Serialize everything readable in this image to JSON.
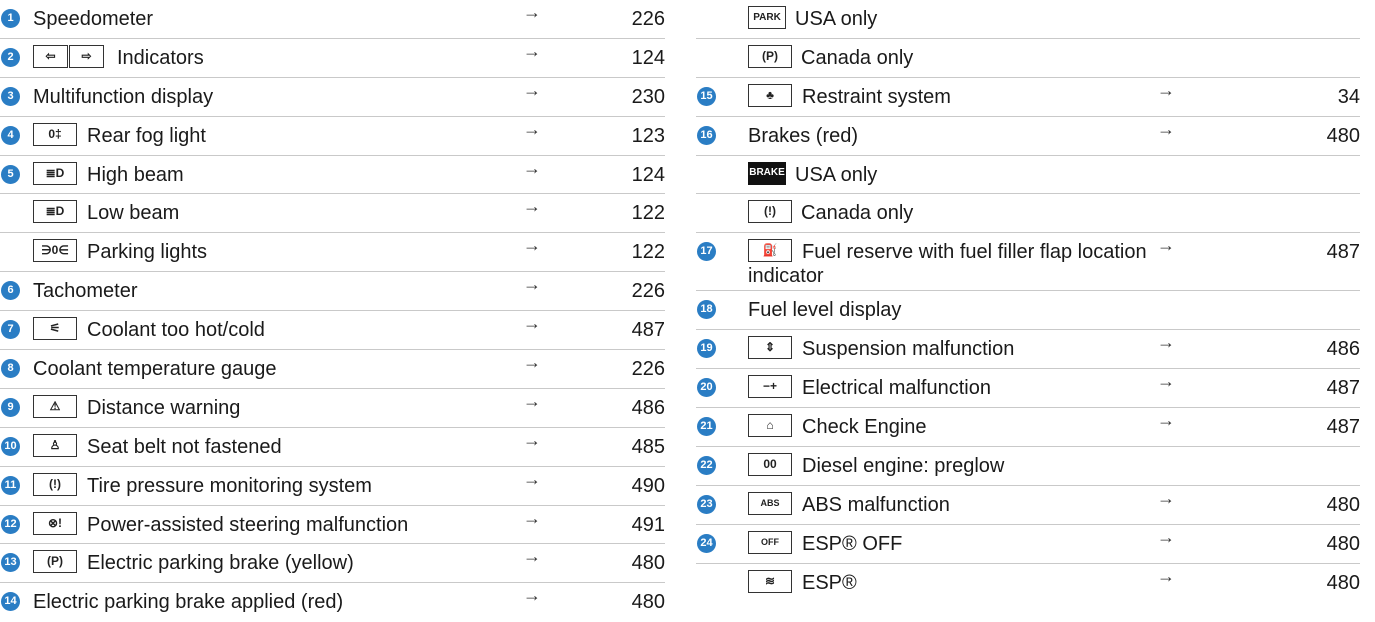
{
  "left": [
    {
      "n": "1",
      "label": "Speedometer",
      "page": "226"
    },
    {
      "n": "2",
      "icon": "◁ ▷",
      "label": "Indicators",
      "page": "124"
    },
    {
      "n": "3",
      "label": "Multifunction display",
      "page": "230"
    },
    {
      "n": "4",
      "icon": "0‡",
      "label": "Rear fog light",
      "page": "123"
    },
    {
      "n": "5",
      "icon": "≣D",
      "label": "High beam",
      "page": "124"
    },
    {
      "n": "",
      "icon": "≣D",
      "label": "Low beam",
      "page": "122"
    },
    {
      "n": "",
      "icon": "∋0∈",
      "label": "Parking lights",
      "page": "122"
    },
    {
      "n": "6",
      "label": "Tachometer",
      "page": "226"
    },
    {
      "n": "7",
      "icon": "⚟",
      "label": "Coolant too hot/cold",
      "page": "487"
    },
    {
      "n": "8",
      "label": "Coolant temperature gauge",
      "page": "226"
    },
    {
      "n": "9",
      "icon": "⚠",
      "label": "Distance warning",
      "page": "486"
    },
    {
      "n": "10",
      "icon": "♙",
      "label": "Seat belt not fastened",
      "page": "485"
    },
    {
      "n": "11",
      "icon": "(!)",
      "label": "Tire pressure monitoring system",
      "page": "490"
    },
    {
      "n": "12",
      "icon": "⊗!",
      "label": "Power-assisted steering malfunction",
      "page": "491"
    },
    {
      "n": "13",
      "icon": "(P)",
      "label": "Electric parking brake (yellow)",
      "page": "480"
    },
    {
      "n": "14",
      "label": "Electric parking brake applied (red)",
      "page": "480"
    }
  ],
  "right": [
    {
      "n": "",
      "icon": "PARK",
      "label": "USA only",
      "page": ""
    },
    {
      "n": "",
      "icon": "(P)",
      "label": "Canada only",
      "page": ""
    },
    {
      "n": "15",
      "icon": "♣",
      "label": "Restraint system",
      "page": "34"
    },
    {
      "n": "16",
      "label": "Brakes (red)",
      "page": "480"
    },
    {
      "n": "",
      "icon": "BRAKE",
      "label": "USA only",
      "page": ""
    },
    {
      "n": "",
      "icon": "(!)",
      "label": "Canada only",
      "page": ""
    },
    {
      "n": "17",
      "icon": "⛽",
      "label": "Fuel reserve with fuel filler flap location indicator",
      "page": "487"
    },
    {
      "n": "18",
      "label": "Fuel level display",
      "page": ""
    },
    {
      "n": "19",
      "icon": "⇕",
      "label": "Suspension malfunction",
      "page": "486"
    },
    {
      "n": "20",
      "icon": "−+",
      "label": "Electrical malfunction",
      "page": "487"
    },
    {
      "n": "21",
      "icon": "⌂",
      "label": "Check Engine",
      "page": "487"
    },
    {
      "n": "22",
      "icon": "00",
      "label": "Diesel engine: preglow",
      "page": ""
    },
    {
      "n": "23",
      "icon": "ABS",
      "label": "ABS malfunction",
      "page": "480"
    },
    {
      "n": "24",
      "icon": "OFF",
      "label": "ESP® OFF",
      "page": "480"
    },
    {
      "n": "",
      "icon": "≋",
      "label": "ESP®",
      "page": "480"
    }
  ],
  "arrow": "→"
}
